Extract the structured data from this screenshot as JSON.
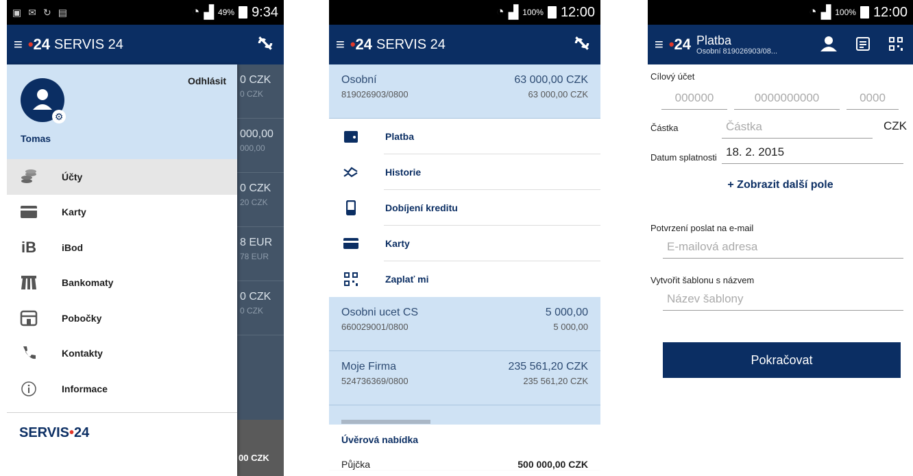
{
  "status1": {
    "time": "9:34",
    "battery": "49%"
  },
  "status2": {
    "time": "12:00",
    "battery": "100%"
  },
  "status3": {
    "time": "12:00",
    "battery": "100%"
  },
  "brand": {
    "logo_num": "24",
    "app_name": "SERVIS 24",
    "footer": "SERVIS",
    "footer_num": "24",
    "accent": "#e2382a",
    "primary": "#0b2e63"
  },
  "drawer": {
    "logout": "Odhlásit",
    "username": "Tomas",
    "items": [
      {
        "label": "Účty",
        "icon": "coins-icon"
      },
      {
        "label": "Karty",
        "icon": "card-icon"
      },
      {
        "label": "iBod",
        "icon": "ibod-icon"
      },
      {
        "label": "Bankomaty",
        "icon": "atm-icon"
      },
      {
        "label": "Pobočky",
        "icon": "branch-icon"
      },
      {
        "label": "Kontakty",
        "icon": "phone-icon"
      },
      {
        "label": "Informace",
        "icon": "info-icon"
      }
    ],
    "behind": [
      {
        "val": "0 CZK",
        "sub": "0 CZK"
      },
      {
        "val": "000,00",
        "sub": "000,00"
      },
      {
        "val": "0 CZK",
        "sub": "20 CZK"
      },
      {
        "val": "8 EUR",
        "sub": "78 EUR"
      },
      {
        "val": "0 CZK",
        "sub": "0 CZK"
      }
    ],
    "behind_bottom": "00 CZK"
  },
  "accounts": {
    "first": {
      "name": "Osobní",
      "number": "819026903/0800",
      "balance": "63 000,00 CZK",
      "available": "63 000,00 CZK"
    },
    "actions": [
      "Platba",
      "Historie",
      "Dobíjení kreditu",
      "Karty",
      "Zaplať mi"
    ],
    "list": [
      {
        "name": "Osobni ucet CS",
        "number": "660029001/0800",
        "balance": "5 000,00",
        "available": "5 000,00"
      },
      {
        "name": "Moje Firma",
        "number": "524736369/0800",
        "balance": "235 561,20 CZK",
        "available": "235 561,20 CZK"
      }
    ],
    "credit_title": "Úvěrová nabídka",
    "credit_label": "Půjčka",
    "credit_value": "500 000,00 CZK"
  },
  "payment": {
    "title": "Platba",
    "subtitle": "Osobní 819026903/08...",
    "target_label": "Cílový účet",
    "prefix_ph": "000000",
    "number_ph": "0000000000",
    "bank_ph": "0000",
    "amount_label": "Částka",
    "amount_ph": "Částka",
    "currency": "CZK",
    "due_label": "Datum splatnosti",
    "due_value": "18. 2. 2015",
    "more": "+ Zobrazit další pole",
    "email_label": "Potvrzení poslat na e-mail",
    "email_ph": "E-mailová adresa",
    "template_label": "Vytvořit šablonu s názvem",
    "template_ph": "Název šablony",
    "continue": "Pokračovat"
  }
}
